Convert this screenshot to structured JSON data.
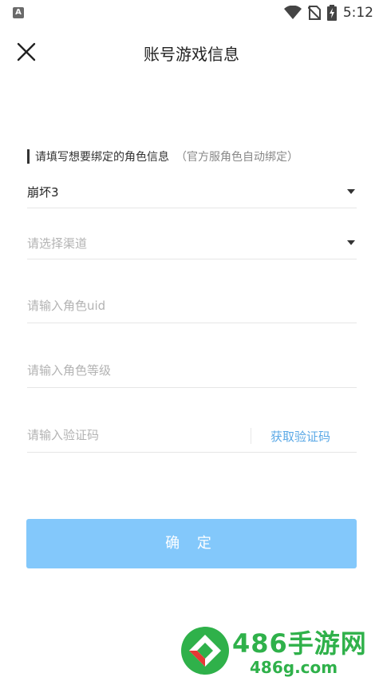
{
  "status_bar": {
    "time": "5:12",
    "notification_badge": "A"
  },
  "header": {
    "title": "账号游戏信息"
  },
  "form": {
    "section_label": "请填写想要绑定的角色信息",
    "section_note": "（官方服角色自动绑定）",
    "game": {
      "value": "崩坏3"
    },
    "channel": {
      "placeholder": "请选择渠道"
    },
    "uid": {
      "placeholder": "请输入角色uid"
    },
    "level": {
      "placeholder": "请输入角色等级"
    },
    "code": {
      "placeholder": "请输入验证码",
      "button": "获取验证码"
    },
    "confirm": "确 定"
  },
  "watermark": {
    "title": "486手游网",
    "url": "486g.com"
  },
  "colors": {
    "accent": "#83c8fb",
    "link": "#5aa8e6",
    "watermark": "#2fb14a"
  }
}
